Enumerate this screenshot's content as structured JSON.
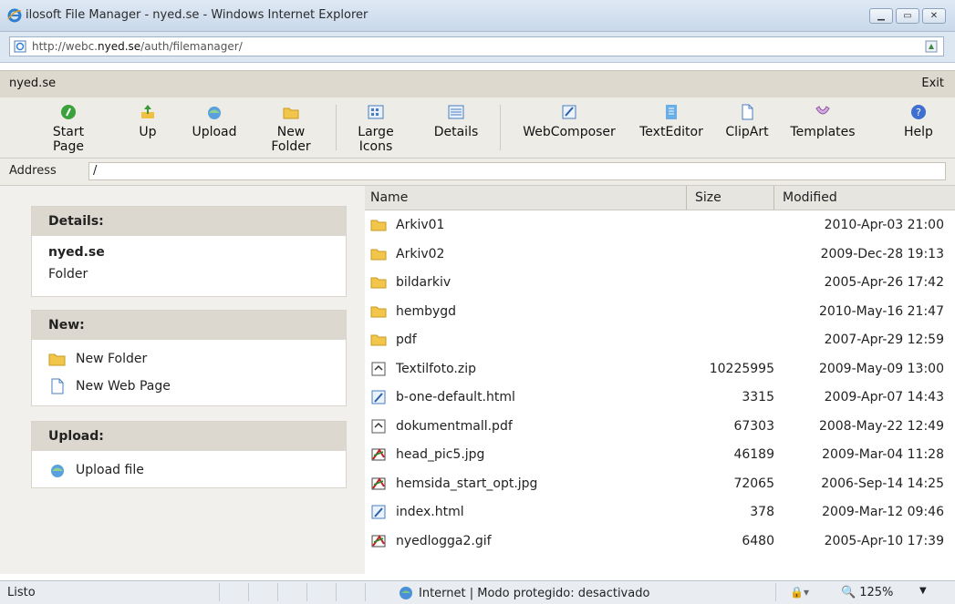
{
  "window": {
    "title": "ilosoft File Manager - nyed.se - Windows Internet Explorer"
  },
  "browser": {
    "url_prefix": "http://webc.",
    "url_host": "nyed.se",
    "url_path": "/auth/filemanager/"
  },
  "app": {
    "site": "nyed.se",
    "exit": "Exit"
  },
  "toolbar": {
    "start": "Start Page",
    "up": "Up",
    "upload": "Upload",
    "new_folder": "New Folder",
    "large": "Large Icons",
    "details": "Details",
    "webcomposer": "WebComposer",
    "texteditor": "TextEditor",
    "clipart": "ClipArt",
    "templates": "Templates",
    "help": "Help"
  },
  "address": {
    "label": "Address",
    "value": "/"
  },
  "details": {
    "header": "Details:",
    "name": "nyed.se",
    "type": "Folder"
  },
  "new": {
    "header": "New:",
    "folder": "New Folder",
    "page": "New Web Page"
  },
  "upload": {
    "header": "Upload:",
    "file": "Upload file"
  },
  "columns": {
    "name": "Name",
    "size": "Size",
    "modified": "Modified"
  },
  "files": [
    {
      "name": "Arkiv01",
      "size": "",
      "modified": "2010-Apr-03 21:00",
      "icon": "folder"
    },
    {
      "name": "Arkiv02",
      "size": "",
      "modified": "2009-Dec-28 19:13",
      "icon": "folder"
    },
    {
      "name": "bildarkiv",
      "size": "",
      "modified": "2005-Apr-26 17:42",
      "icon": "folder"
    },
    {
      "name": "hembygd",
      "size": "",
      "modified": "2010-May-16 21:47",
      "icon": "folder"
    },
    {
      "name": "pdf",
      "size": "",
      "modified": "2007-Apr-29 12:59",
      "icon": "folder"
    },
    {
      "name": "Textilfoto.zip",
      "size": "10225995",
      "modified": "2009-May-09 13:00",
      "icon": "generic"
    },
    {
      "name": "b-one-default.html",
      "size": "3315",
      "modified": "2009-Apr-07 14:43",
      "icon": "html"
    },
    {
      "name": "dokumentmall.pdf",
      "size": "67303",
      "modified": "2008-May-22 12:49",
      "icon": "generic"
    },
    {
      "name": "head_pic5.jpg",
      "size": "46189",
      "modified": "2009-Mar-04 11:28",
      "icon": "image"
    },
    {
      "name": "hemsida_start_opt.jpg",
      "size": "72065",
      "modified": "2006-Sep-14 14:25",
      "icon": "image"
    },
    {
      "name": "index.html",
      "size": "378",
      "modified": "2009-Mar-12 09:46",
      "icon": "html"
    },
    {
      "name": "nyedlogga2.gif",
      "size": "6480",
      "modified": "2005-Apr-10 17:39",
      "icon": "image"
    }
  ],
  "status": {
    "text": "Listo",
    "zone": "Internet | Modo protegido: desactivado",
    "zoom": "125%"
  }
}
